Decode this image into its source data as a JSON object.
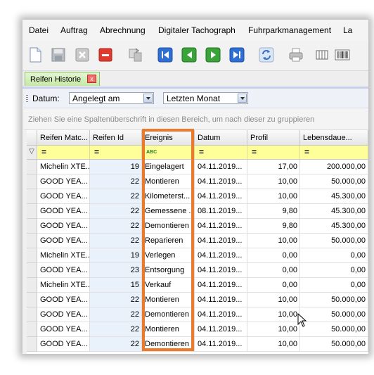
{
  "menu": [
    "Datei",
    "Auftrag",
    "Abrechnung",
    "Digitaler Tachograph",
    "Fuhrparkmanagement",
    "La"
  ],
  "toolbar": {
    "icons": [
      "new-document-icon",
      "save-icon",
      "cancel-icon",
      "delete-icon",
      "copy-icon",
      "first-record-icon",
      "previous-record-icon",
      "next-record-icon",
      "last-record-icon",
      "refresh-icon",
      "print-icon",
      "columns-icon",
      "barcode-icon"
    ]
  },
  "tab": {
    "label": "Reifen Historie",
    "close": "x"
  },
  "filter": {
    "label": "Datum:",
    "field": "Angelegt am",
    "period": "Letzten Monat"
  },
  "group_hint": "Ziehen Sie eine Spaltenüberschrift in diesen Bereich, um nach dieser zu gruppieren",
  "columns": [
    "Reifen Matc...",
    "Reifen Id",
    "Ereignis",
    "Datum",
    "Profil",
    "Lebensdaue..."
  ],
  "filter_row": {
    "text_op": "=",
    "ereignis_op": "ABC"
  },
  "rows": [
    [
      "Michelin XTE...",
      "19",
      "Eingelagert",
      "04.11.2019...",
      "17,00",
      "200.000,00"
    ],
    [
      "GOOD YEA...",
      "22",
      "Montieren",
      "04.11.2019...",
      "10,00",
      "50.000,00"
    ],
    [
      "GOOD YEA...",
      "22",
      "Kilometerst...",
      "04.11.2019...",
      "10,00",
      "45.300,00"
    ],
    [
      "GOOD YEA...",
      "22",
      "Gemessene ...",
      "08.11.2019...",
      "9,80",
      "45.300,00"
    ],
    [
      "GOOD YEA...",
      "22",
      "Demontieren",
      "04.11.2019...",
      "9,80",
      "45.300,00"
    ],
    [
      "GOOD YEA...",
      "22",
      "Reparieren",
      "04.11.2019...",
      "10,00",
      "50.000,00"
    ],
    [
      "Michelin XTE...",
      "19",
      "Verlegen",
      "04.11.2019...",
      "0,00",
      "0,00"
    ],
    [
      "GOOD YEA...",
      "23",
      "Entsorgung",
      "04.11.2019...",
      "0,00",
      "0,00"
    ],
    [
      "Michelin XTE...",
      "15",
      "Verkauf",
      "04.11.2019...",
      "0,00",
      "0,00"
    ],
    [
      "GOOD YEA...",
      "22",
      "Montieren",
      "04.11.2019...",
      "10,00",
      "50.000,00"
    ],
    [
      "GOOD YEA...",
      "22",
      "Demontieren",
      "04.11.2019...",
      "10,00",
      "50.000,00"
    ],
    [
      "GOOD YEA...",
      "22",
      "Montieren",
      "04.11.2019...",
      "10,00",
      "50.000,00"
    ],
    [
      "GOOD YEA...",
      "22",
      "Demontieren",
      "04.11.2019...",
      "10,00",
      "50.000,00"
    ]
  ],
  "colors": {
    "highlight": "#ec7a2c",
    "filter_row": "#ffff99",
    "id_column": "#e9f1fb"
  }
}
